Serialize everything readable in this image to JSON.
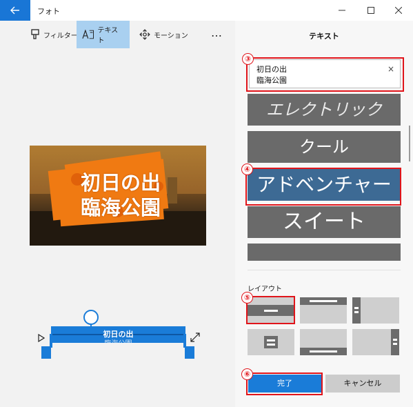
{
  "window": {
    "title": "フォト",
    "back_icon": "arrow-left-icon",
    "accent": "#1976d6"
  },
  "toolbar": {
    "filter_label": "フィルター",
    "text_label": "テキスト",
    "motion_label": "モーション",
    "more_label": "…"
  },
  "preview": {
    "caption_line1": "初日の出",
    "caption_line2": "臨海公園",
    "splash_color": "#f07a12"
  },
  "timeline": {
    "clip_label": "初日の出",
    "clip_label2": "臨海公園"
  },
  "panel": {
    "title": "テキスト",
    "text_line1": "初日の出",
    "text_line2": "臨海公園",
    "clear_label": "×",
    "styles": [
      {
        "label": "エレクトリック"
      },
      {
        "label": "クール"
      },
      {
        "label": "アドベンチャー",
        "selected": true
      },
      {
        "label": "スイート"
      },
      {
        "label": ""
      }
    ],
    "selected_color": "#3d6a94",
    "layout_label": "レイアウト",
    "done_label": "完了",
    "cancel_label": "キャンセル"
  },
  "annotations": {
    "badge3": "③",
    "badge4": "④",
    "badge5": "⑤",
    "badge6": "⑥",
    "color": "#e0141a"
  }
}
